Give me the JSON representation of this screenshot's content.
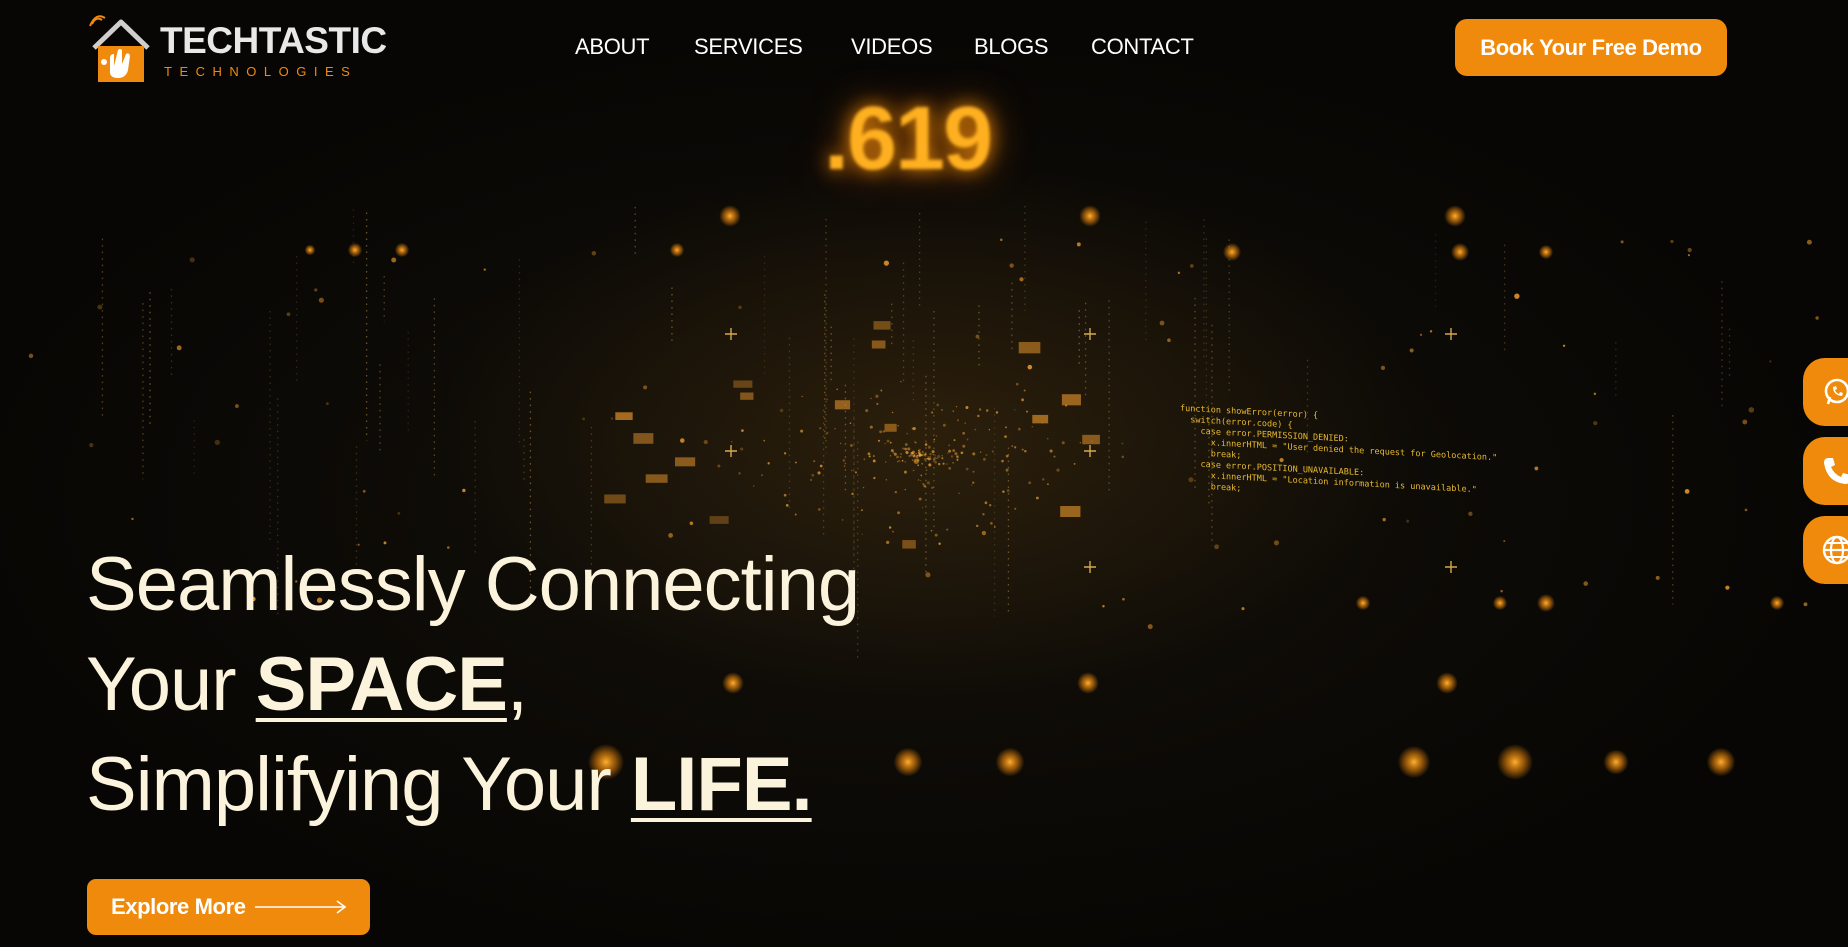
{
  "header": {
    "logo": {
      "name": "TECHTASTIC",
      "subtitle": "TECHNOLOGIES"
    },
    "nav": [
      {
        "label": "ABOUT"
      },
      {
        "label": "SERVICES"
      },
      {
        "label": "VIDEOS"
      },
      {
        "label": "BLOGS"
      },
      {
        "label": "CONTACT"
      }
    ],
    "cta_label": "Book Your Free Demo"
  },
  "hero": {
    "glow_number": ".619",
    "code_lines": [
      "function showError(error) {",
      "  switch(error.code) {",
      "    case error.PERMISSION_DENIED:",
      "      x.innerHTML = \"User denied the request for Geolocation.\"",
      "      break;",
      "    case error.POSITION_UNAVAILABLE:",
      "      x.innerHTML = \"Location information is unavailable.\"",
      "      break;"
    ],
    "headline": {
      "line1": "Seamlessly Connecting",
      "line2_prefix": "Your ",
      "line2_emphasis": "SPACE",
      "line2_suffix": ",",
      "line3_prefix": "Simplifying Your ",
      "line3_emphasis": "LIFE."
    },
    "explore_label": "Explore More"
  },
  "side_contacts": [
    {
      "icon": "whatsapp-icon"
    },
    {
      "icon": "phone-icon"
    },
    {
      "icon": "globe-icon"
    }
  ],
  "colors": {
    "accent": "#f08a0c",
    "headline": "#fbf3dc",
    "background": "#0b0906"
  }
}
